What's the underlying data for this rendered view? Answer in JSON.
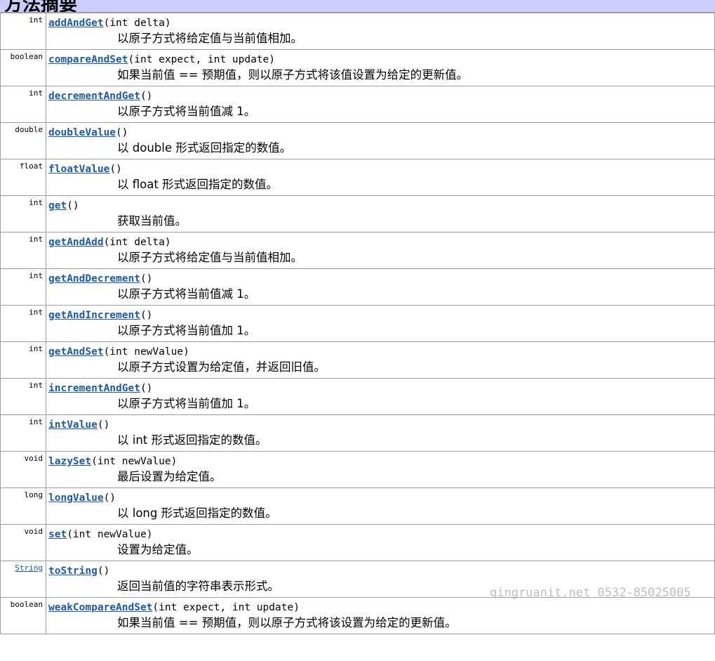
{
  "header": {
    "title": "方法摘要"
  },
  "watermark": "qingruanit.net 0532-85025005",
  "colors": {
    "header_bg": "#ccccff",
    "link": "#1d5aa8",
    "border": "#9d9d9d"
  },
  "methods": [
    {
      "type": "int",
      "name": "addAndGet",
      "params": "(int delta)",
      "desc": "以原子方式将给定值与当前值相加。"
    },
    {
      "type": "boolean",
      "name": "compareAndSet",
      "params": "(int expect, int update)",
      "desc": "如果当前值 == 预期值，则以原子方式将该值设置为给定的更新值。"
    },
    {
      "type": "int",
      "name": "decrementAndGet",
      "params": "()",
      "desc": "以原子方式将当前值减 1。"
    },
    {
      "type": "double",
      "name": "doubleValue",
      "params": "()",
      "desc": "以 double 形式返回指定的数值。"
    },
    {
      "type": "float",
      "name": "floatValue",
      "params": "()",
      "desc": "以 float 形式返回指定的数值。"
    },
    {
      "type": "int",
      "name": "get",
      "params": "()",
      "desc": "获取当前值。"
    },
    {
      "type": "int",
      "name": "getAndAdd",
      "params": "(int delta)",
      "desc": "以原子方式将给定值与当前值相加。"
    },
    {
      "type": "int",
      "name": "getAndDecrement",
      "params": "()",
      "desc": "以原子方式将当前值减 1。"
    },
    {
      "type": "int",
      "name": "getAndIncrement",
      "params": "()",
      "desc": "以原子方式将当前值加 1。"
    },
    {
      "type": "int",
      "name": "getAndSet",
      "params": "(int newValue)",
      "desc": "以原子方式设置为给定值，并返回旧值。"
    },
    {
      "type": "int",
      "name": "incrementAndGet",
      "params": "()",
      "desc": "以原子方式将当前值加 1。"
    },
    {
      "type": "int",
      "name": "intValue",
      "params": "()",
      "desc": "以 int 形式返回指定的数值。"
    },
    {
      "type": "void",
      "name": "lazySet",
      "params": "(int newValue)",
      "desc": "最后设置为给定值。"
    },
    {
      "type": "long",
      "name": "longValue",
      "params": "()",
      "desc": "以 long 形式返回指定的数值。"
    },
    {
      "type": "void",
      "name": "set",
      "params": "(int newValue)",
      "desc": "设置为给定值。"
    },
    {
      "type": "String",
      "type_is_link": true,
      "name": "toString",
      "params": "()",
      "desc": "返回当前值的字符串表示形式。"
    },
    {
      "type": "boolean",
      "name": "weakCompareAndSet",
      "params": "(int expect, int update)",
      "desc": "如果当前值 == 预期值，则以原子方式将该设置为给定的更新值。"
    }
  ]
}
